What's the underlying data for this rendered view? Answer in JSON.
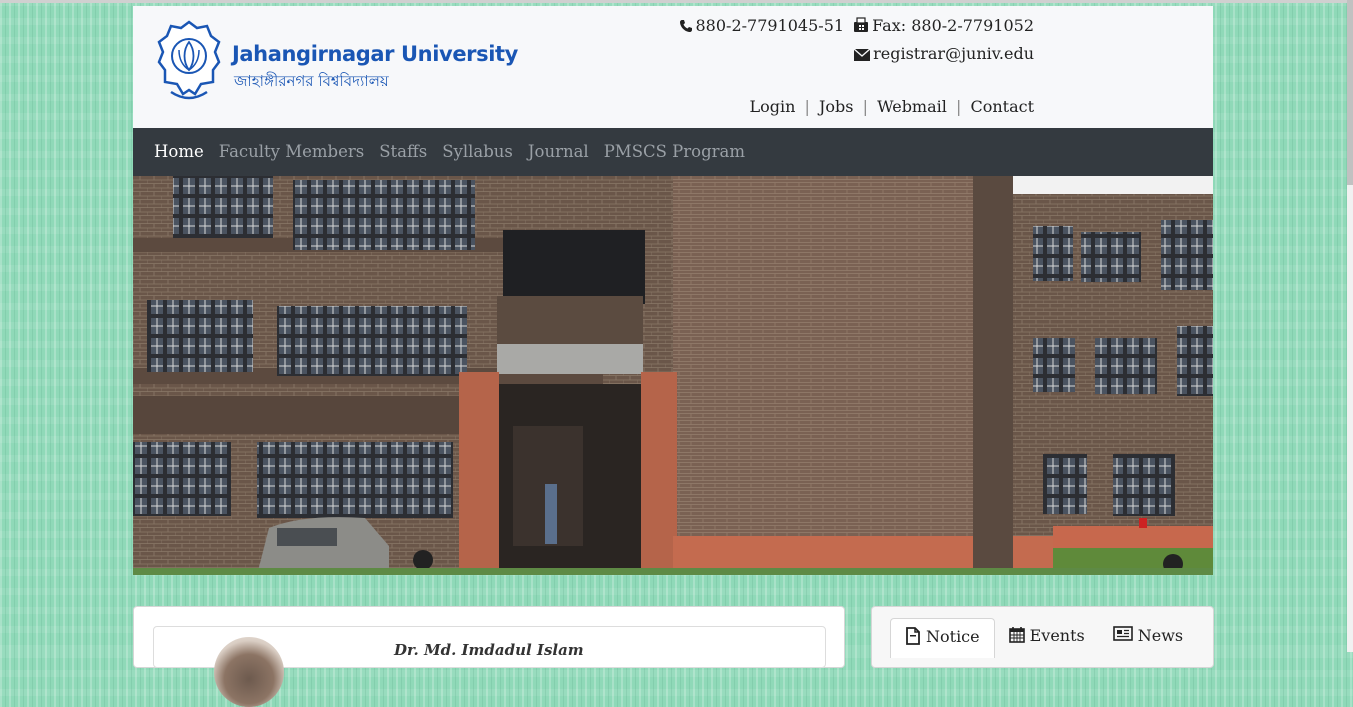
{
  "header": {
    "brand_name_en": "Jahangirnagar University",
    "brand_name_bn": "জাহাঙ্গীরনগর বিশ্ববিদ্যালয়",
    "phone": "880-2-7791045-51",
    "fax": "Fax: 880-2-7791052",
    "email": "registrar@juniv.edu",
    "links": {
      "login": "Login",
      "jobs": "Jobs",
      "webmail": "Webmail",
      "contact": "Contact",
      "separator": "|"
    }
  },
  "nav": {
    "items": [
      {
        "label": "Home",
        "active": true
      },
      {
        "label": "Faculty Members",
        "active": false
      },
      {
        "label": "Staffs",
        "active": false
      },
      {
        "label": "Syllabus",
        "active": false
      },
      {
        "label": "Journal",
        "active": false
      },
      {
        "label": "PMSCS Program",
        "active": false
      }
    ]
  },
  "profile_card": {
    "name": "Dr. Md. Imdadul Islam"
  },
  "tabs_card": {
    "tabs": [
      {
        "label": "Notice",
        "icon": "file-icon",
        "active": true
      },
      {
        "label": "Events",
        "icon": "calendar-icon",
        "active": false
      },
      {
        "label": "News",
        "icon": "newspaper-icon",
        "active": false
      }
    ]
  },
  "colors": {
    "brand_blue": "#1a56b4",
    "nav_bg": "#343a40",
    "page_bg": "#8fd9b8"
  }
}
